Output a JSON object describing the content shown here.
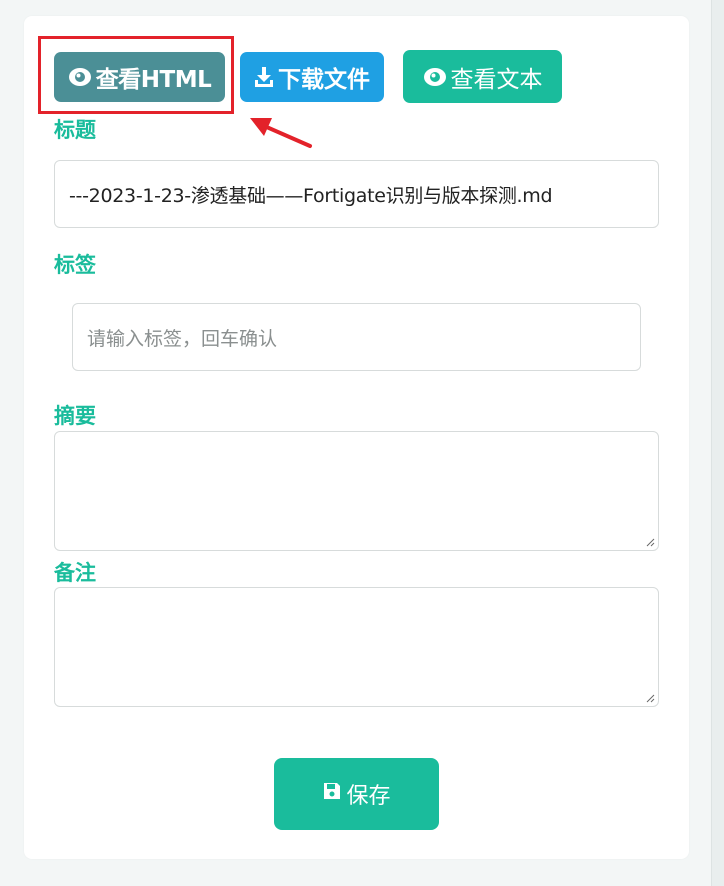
{
  "toolbar": {
    "view_html_label": "查看HTML",
    "download_label": "下载文件",
    "view_text_label": "查看文本"
  },
  "form": {
    "title_label": "标题",
    "title_value": "---2023-1-23-渗透基础——Fortigate识别与版本探测.md",
    "tags_label": "标签",
    "tags_placeholder": "请输入标签，回车确认",
    "summary_label": "摘要",
    "remark_label": "备注",
    "save_label": "保存"
  },
  "colors": {
    "accent": "#1abc9c",
    "view_html_button": "#4b8f96",
    "download_button": "#1fa0e3",
    "highlight": "#e3222a"
  },
  "icons": {
    "view_html": "eye-icon",
    "download": "download-icon",
    "view_text": "eye-icon",
    "save": "floppy-disk-icon"
  }
}
